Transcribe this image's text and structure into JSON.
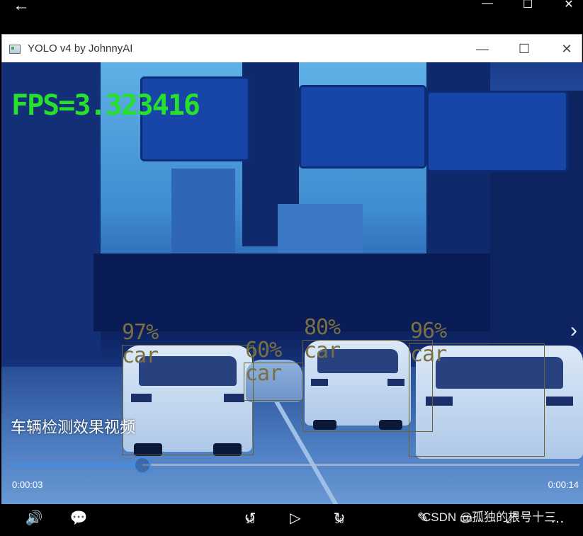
{
  "outer_bar": {
    "back_icon": "arrow-left-icon",
    "minimize_icon": "minimize-icon",
    "maximize_icon": "maximize-icon",
    "close_icon": "close-icon"
  },
  "window": {
    "title": "YOLO v4 by JohnnyAI",
    "minimize_glyph": "—",
    "maximize_glyph": "☐",
    "close_glyph": "✕"
  },
  "video": {
    "fps_text": "FPS=3.323416",
    "detections": [
      {
        "confidence": "97%",
        "label": "car"
      },
      {
        "confidence": "60%",
        "label": "car"
      },
      {
        "confidence": "80%",
        "label": "car"
      },
      {
        "confidence": "96%",
        "label": "car"
      }
    ],
    "caption": "车辆检测效果视频",
    "next_glyph": "›",
    "colors": {
      "fps": "#27e02b",
      "box": "#6b6330",
      "progress": "#3d8ee8"
    }
  },
  "playback": {
    "current_time": "0:00:03",
    "total_time": "0:00:14",
    "progress": 0.23
  },
  "controls": {
    "volume": "🔊",
    "subtitles": "💬",
    "skip_back_label": "10",
    "play": "▷",
    "skip_forward_label": "30",
    "edit": "✎",
    "miniview": "▭",
    "fullscreen": "⤢",
    "more": "…"
  },
  "watermark": "CSDN @孤独的根号十三"
}
